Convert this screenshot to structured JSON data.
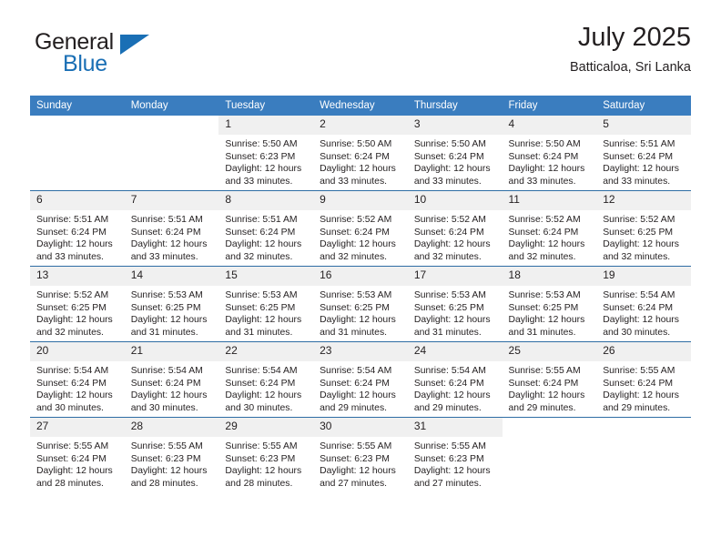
{
  "brand": {
    "name_top": "General",
    "name_bottom": "Blue",
    "triangle_color": "#1a6fb5"
  },
  "header": {
    "title": "July 2025",
    "subtitle": "Batticaloa, Sri Lanka"
  },
  "theme": {
    "header_bg": "#3a7dbf",
    "row_divider": "#2e6da4",
    "daynum_bg": "#f0f0f0",
    "text": "#231f20"
  },
  "weekdays": [
    "Sunday",
    "Monday",
    "Tuesday",
    "Wednesday",
    "Thursday",
    "Friday",
    "Saturday"
  ],
  "weeks": [
    [
      {
        "day": "",
        "blank": true
      },
      {
        "day": "",
        "blank": true
      },
      {
        "day": "1",
        "sunrise": "Sunrise: 5:50 AM",
        "sunset": "Sunset: 6:23 PM",
        "daylight_1": "Daylight: 12 hours",
        "daylight_2": "and 33 minutes."
      },
      {
        "day": "2",
        "sunrise": "Sunrise: 5:50 AM",
        "sunset": "Sunset: 6:24 PM",
        "daylight_1": "Daylight: 12 hours",
        "daylight_2": "and 33 minutes."
      },
      {
        "day": "3",
        "sunrise": "Sunrise: 5:50 AM",
        "sunset": "Sunset: 6:24 PM",
        "daylight_1": "Daylight: 12 hours",
        "daylight_2": "and 33 minutes."
      },
      {
        "day": "4",
        "sunrise": "Sunrise: 5:50 AM",
        "sunset": "Sunset: 6:24 PM",
        "daylight_1": "Daylight: 12 hours",
        "daylight_2": "and 33 minutes."
      },
      {
        "day": "5",
        "sunrise": "Sunrise: 5:51 AM",
        "sunset": "Sunset: 6:24 PM",
        "daylight_1": "Daylight: 12 hours",
        "daylight_2": "and 33 minutes."
      }
    ],
    [
      {
        "day": "6",
        "sunrise": "Sunrise: 5:51 AM",
        "sunset": "Sunset: 6:24 PM",
        "daylight_1": "Daylight: 12 hours",
        "daylight_2": "and 33 minutes."
      },
      {
        "day": "7",
        "sunrise": "Sunrise: 5:51 AM",
        "sunset": "Sunset: 6:24 PM",
        "daylight_1": "Daylight: 12 hours",
        "daylight_2": "and 33 minutes."
      },
      {
        "day": "8",
        "sunrise": "Sunrise: 5:51 AM",
        "sunset": "Sunset: 6:24 PM",
        "daylight_1": "Daylight: 12 hours",
        "daylight_2": "and 32 minutes."
      },
      {
        "day": "9",
        "sunrise": "Sunrise: 5:52 AM",
        "sunset": "Sunset: 6:24 PM",
        "daylight_1": "Daylight: 12 hours",
        "daylight_2": "and 32 minutes."
      },
      {
        "day": "10",
        "sunrise": "Sunrise: 5:52 AM",
        "sunset": "Sunset: 6:24 PM",
        "daylight_1": "Daylight: 12 hours",
        "daylight_2": "and 32 minutes."
      },
      {
        "day": "11",
        "sunrise": "Sunrise: 5:52 AM",
        "sunset": "Sunset: 6:24 PM",
        "daylight_1": "Daylight: 12 hours",
        "daylight_2": "and 32 minutes."
      },
      {
        "day": "12",
        "sunrise": "Sunrise: 5:52 AM",
        "sunset": "Sunset: 6:25 PM",
        "daylight_1": "Daylight: 12 hours",
        "daylight_2": "and 32 minutes."
      }
    ],
    [
      {
        "day": "13",
        "sunrise": "Sunrise: 5:52 AM",
        "sunset": "Sunset: 6:25 PM",
        "daylight_1": "Daylight: 12 hours",
        "daylight_2": "and 32 minutes."
      },
      {
        "day": "14",
        "sunrise": "Sunrise: 5:53 AM",
        "sunset": "Sunset: 6:25 PM",
        "daylight_1": "Daylight: 12 hours",
        "daylight_2": "and 31 minutes."
      },
      {
        "day": "15",
        "sunrise": "Sunrise: 5:53 AM",
        "sunset": "Sunset: 6:25 PM",
        "daylight_1": "Daylight: 12 hours",
        "daylight_2": "and 31 minutes."
      },
      {
        "day": "16",
        "sunrise": "Sunrise: 5:53 AM",
        "sunset": "Sunset: 6:25 PM",
        "daylight_1": "Daylight: 12 hours",
        "daylight_2": "and 31 minutes."
      },
      {
        "day": "17",
        "sunrise": "Sunrise: 5:53 AM",
        "sunset": "Sunset: 6:25 PM",
        "daylight_1": "Daylight: 12 hours",
        "daylight_2": "and 31 minutes."
      },
      {
        "day": "18",
        "sunrise": "Sunrise: 5:53 AM",
        "sunset": "Sunset: 6:25 PM",
        "daylight_1": "Daylight: 12 hours",
        "daylight_2": "and 31 minutes."
      },
      {
        "day": "19",
        "sunrise": "Sunrise: 5:54 AM",
        "sunset": "Sunset: 6:24 PM",
        "daylight_1": "Daylight: 12 hours",
        "daylight_2": "and 30 minutes."
      }
    ],
    [
      {
        "day": "20",
        "sunrise": "Sunrise: 5:54 AM",
        "sunset": "Sunset: 6:24 PM",
        "daylight_1": "Daylight: 12 hours",
        "daylight_2": "and 30 minutes."
      },
      {
        "day": "21",
        "sunrise": "Sunrise: 5:54 AM",
        "sunset": "Sunset: 6:24 PM",
        "daylight_1": "Daylight: 12 hours",
        "daylight_2": "and 30 minutes."
      },
      {
        "day": "22",
        "sunrise": "Sunrise: 5:54 AM",
        "sunset": "Sunset: 6:24 PM",
        "daylight_1": "Daylight: 12 hours",
        "daylight_2": "and 30 minutes."
      },
      {
        "day": "23",
        "sunrise": "Sunrise: 5:54 AM",
        "sunset": "Sunset: 6:24 PM",
        "daylight_1": "Daylight: 12 hours",
        "daylight_2": "and 29 minutes."
      },
      {
        "day": "24",
        "sunrise": "Sunrise: 5:54 AM",
        "sunset": "Sunset: 6:24 PM",
        "daylight_1": "Daylight: 12 hours",
        "daylight_2": "and 29 minutes."
      },
      {
        "day": "25",
        "sunrise": "Sunrise: 5:55 AM",
        "sunset": "Sunset: 6:24 PM",
        "daylight_1": "Daylight: 12 hours",
        "daylight_2": "and 29 minutes."
      },
      {
        "day": "26",
        "sunrise": "Sunrise: 5:55 AM",
        "sunset": "Sunset: 6:24 PM",
        "daylight_1": "Daylight: 12 hours",
        "daylight_2": "and 29 minutes."
      }
    ],
    [
      {
        "day": "27",
        "sunrise": "Sunrise: 5:55 AM",
        "sunset": "Sunset: 6:24 PM",
        "daylight_1": "Daylight: 12 hours",
        "daylight_2": "and 28 minutes."
      },
      {
        "day": "28",
        "sunrise": "Sunrise: 5:55 AM",
        "sunset": "Sunset: 6:23 PM",
        "daylight_1": "Daylight: 12 hours",
        "daylight_2": "and 28 minutes."
      },
      {
        "day": "29",
        "sunrise": "Sunrise: 5:55 AM",
        "sunset": "Sunset: 6:23 PM",
        "daylight_1": "Daylight: 12 hours",
        "daylight_2": "and 28 minutes."
      },
      {
        "day": "30",
        "sunrise": "Sunrise: 5:55 AM",
        "sunset": "Sunset: 6:23 PM",
        "daylight_1": "Daylight: 12 hours",
        "daylight_2": "and 27 minutes."
      },
      {
        "day": "31",
        "sunrise": "Sunrise: 5:55 AM",
        "sunset": "Sunset: 6:23 PM",
        "daylight_1": "Daylight: 12 hours",
        "daylight_2": "and 27 minutes."
      },
      {
        "day": "",
        "blank": true
      },
      {
        "day": "",
        "blank": true
      }
    ]
  ]
}
